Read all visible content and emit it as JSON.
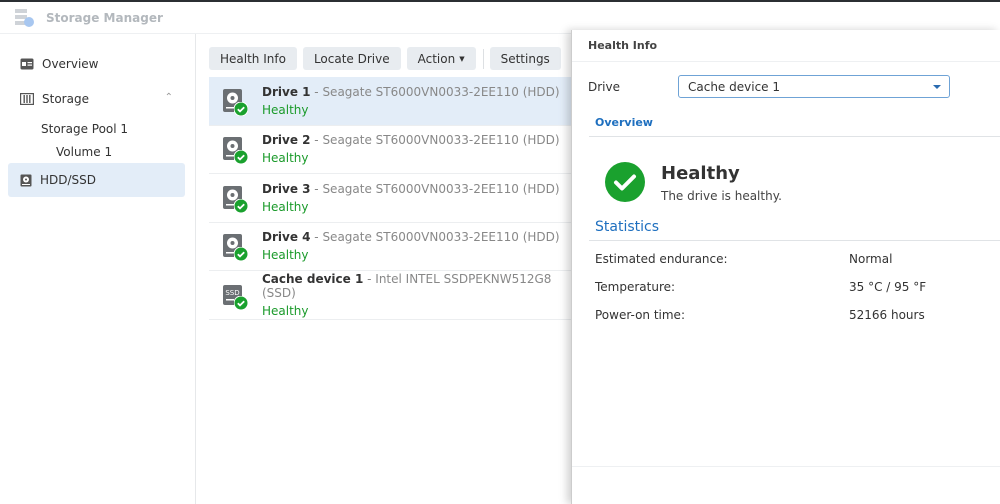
{
  "app": {
    "title": "Storage Manager"
  },
  "sidebar": {
    "items": [
      {
        "label": "Overview"
      },
      {
        "label": "Storage"
      },
      {
        "label": "Storage Pool 1"
      },
      {
        "label": "Volume 1"
      },
      {
        "label": "HDD/SSD"
      }
    ]
  },
  "toolbar": {
    "health_info": "Health Info",
    "locate_drive": "Locate Drive",
    "action": "Action",
    "settings": "Settings"
  },
  "drives": [
    {
      "name": "Drive 1",
      "model": " - Seagate ST6000VN0033-2EE110 (HDD)",
      "status": "Healthy"
    },
    {
      "name": "Drive 2",
      "model": " - Seagate ST6000VN0033-2EE110 (HDD)",
      "status": "Healthy"
    },
    {
      "name": "Drive 3",
      "model": " - Seagate ST6000VN0033-2EE110 (HDD)",
      "status": "Healthy"
    },
    {
      "name": "Drive 4",
      "model": " - Seagate ST6000VN0033-2EE110 (HDD)",
      "status": "Healthy"
    },
    {
      "name": "Cache device 1",
      "model": " - Intel INTEL SSDPEKNW512G8 (SSD)",
      "status": "Healthy"
    }
  ],
  "panel": {
    "title": "Health Info",
    "drive_label": "Drive",
    "drive_value": "Cache device 1",
    "tab": "Overview",
    "health_title": "Healthy",
    "health_desc": "The drive is healthy.",
    "statistics": "Statistics",
    "stats": [
      {
        "label": "Estimated endurance:",
        "value": "Normal"
      },
      {
        "label": "Temperature:",
        "value": "35 °C / 95 °F"
      },
      {
        "label": "Power-on time:",
        "value": "52166 hours"
      }
    ]
  },
  "colors": {
    "healthy": "#1a9a2a",
    "accent": "#1e6fbf",
    "selected": "#e3edf8"
  }
}
